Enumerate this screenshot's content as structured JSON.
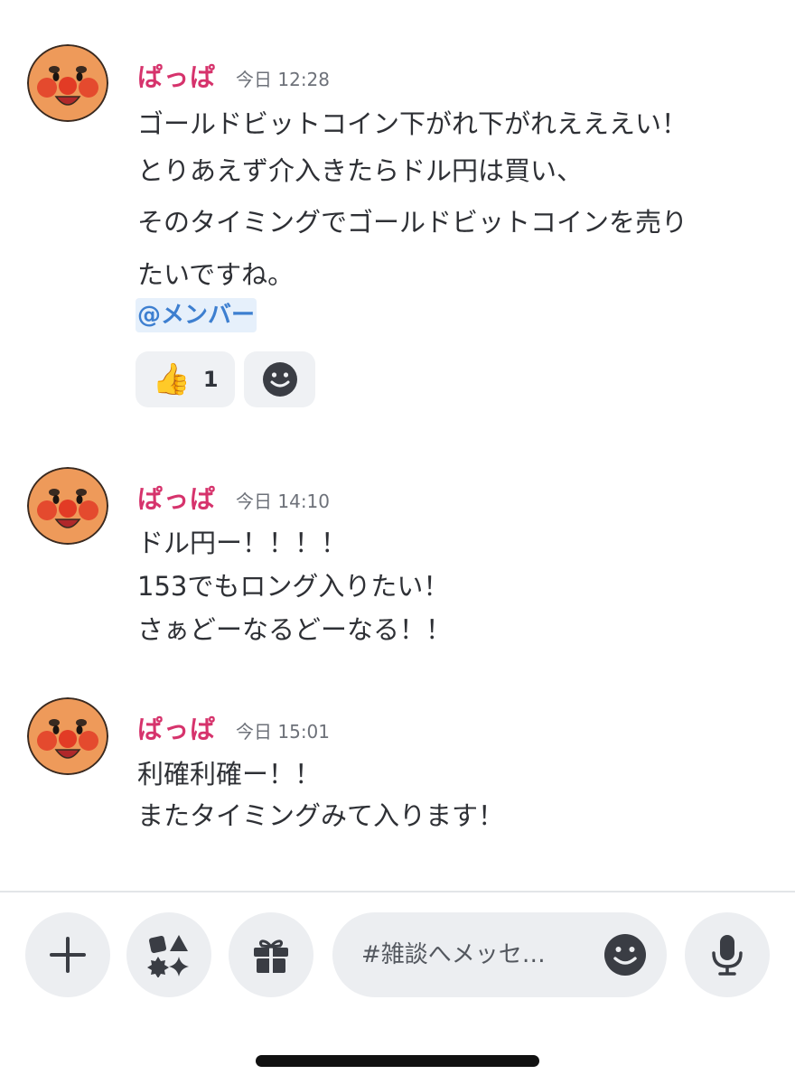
{
  "messages": [
    {
      "author": "ぱっぱ",
      "time": "今日 12:28",
      "lines": [
        "ゴールドビットコイン下がれ下がれえええい！",
        "とりあえず介入きたらドル円は買い、",
        "そのタイミングでゴールドビットコインを売り",
        "たいですね。"
      ],
      "mention": "@メンバー",
      "reaction": {
        "emoji": "👍",
        "count": "1"
      }
    },
    {
      "author": "ぱっぱ",
      "time": "今日 14:10",
      "lines": [
        "ドル円ー！！！！",
        "153でもロング入りたい！",
        "さぁどーなるどーなる！！"
      ]
    },
    {
      "author": "ぱっぱ",
      "time": "今日 15:01",
      "lines": [
        "利確利確ー！！",
        "またタイミングみて入ります！"
      ]
    }
  ],
  "composer": {
    "placeholder": "#雑談へメッセ…",
    "icons": [
      "plus-icon",
      "apps-icon",
      "gift-icon",
      "emoji-icon",
      "microphone-icon"
    ]
  },
  "colors": {
    "author": "#d6336c",
    "mention": "#3d7fd0",
    "mention_bg": "#e6f0fb"
  }
}
